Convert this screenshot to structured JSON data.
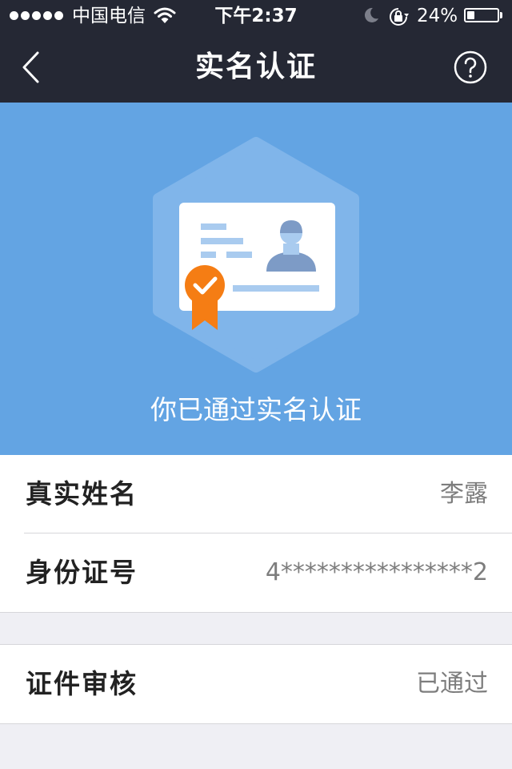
{
  "status_bar": {
    "carrier": "中国电信",
    "time": "下午2:37",
    "battery_percent": "24%",
    "battery_level": 0.24,
    "icons": [
      "signal-dots",
      "wifi-icon",
      "moon-icon",
      "rotation-lock-icon",
      "battery-icon"
    ]
  },
  "nav": {
    "title": "实名认证",
    "back_icon": "chevron-left-icon",
    "help_icon": "question-circle-icon"
  },
  "hero": {
    "message": "你已通过实名认证",
    "illustration": "id-card-with-verified-badge",
    "colors": {
      "background": "#63a4e3",
      "badge": "#f57d14"
    }
  },
  "rows": {
    "name": {
      "label": "真实姓名",
      "value": "李露"
    },
    "id_number": {
      "label": "身份证号",
      "value": "4****************2"
    },
    "review": {
      "label": "证件审核",
      "value": "已通过"
    }
  },
  "colors": {
    "nav_background": "#252834",
    "page_background": "#efeff4"
  }
}
